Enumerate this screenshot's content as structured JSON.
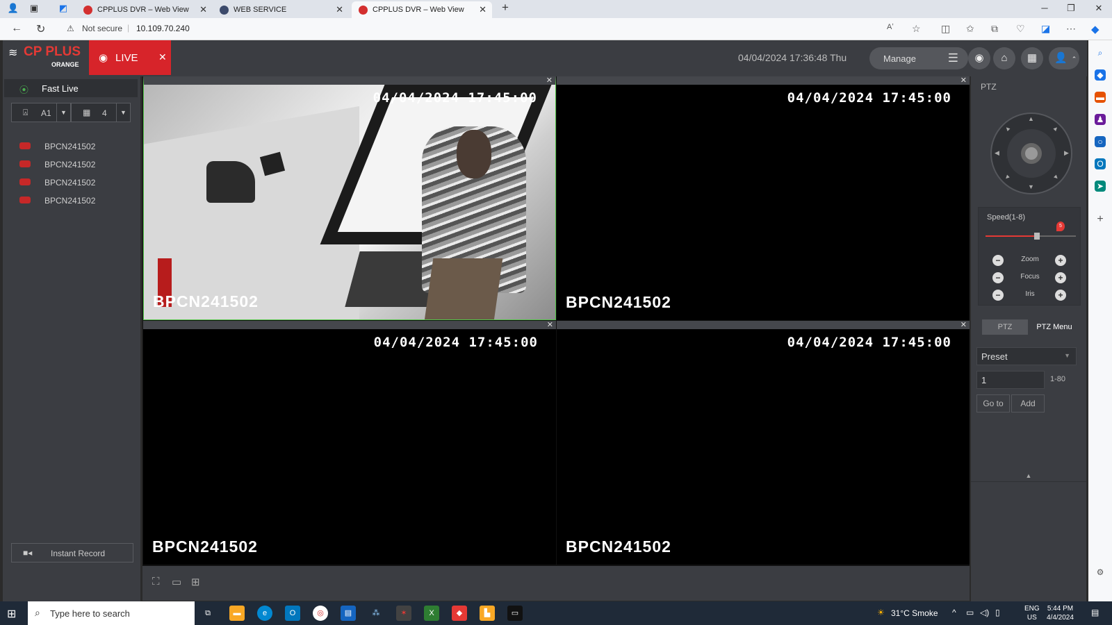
{
  "browser": {
    "tabs": [
      {
        "title": "CPPLUS DVR – Web View",
        "active": false
      },
      {
        "title": "WEB SERVICE",
        "active": false
      },
      {
        "title": "CPPLUS DVR – Web View",
        "active": true
      }
    ],
    "security_label": "Not secure",
    "url": "10.109.70.240"
  },
  "app": {
    "logo_main": "CP PLUS",
    "logo_sub": "ORANGE",
    "live_tab_label": "LIVE",
    "datetime": "04/04/2024 17:36:48 Thu",
    "manage_label": "Manage"
  },
  "sidebar": {
    "fast_live_label": "Fast Live",
    "channel_selector": "A1",
    "layout_selector": "4",
    "cameras": [
      "BPCN241502",
      "BPCN241502",
      "BPCN241502",
      "BPCN241502"
    ],
    "instant_record_label": "Instant Record"
  },
  "video": {
    "panes": [
      {
        "timestamp": "04/04/2024 17:45:00",
        "camera": "BPCN241502",
        "active": true
      },
      {
        "timestamp": "04/04/2024 17:45:00",
        "camera": "BPCN241502",
        "active": false
      },
      {
        "timestamp": "04/04/2024 17:45:00",
        "camera": "BPCN241502",
        "active": false
      },
      {
        "timestamp": "04/04/2024 17:45:00",
        "camera": "BPCN241502",
        "active": false
      }
    ]
  },
  "ptz": {
    "title": "PTZ",
    "speed_label": "Speed(1-8)",
    "speed_value": "5",
    "speed_fraction": 0.57,
    "zoom_label": "Zoom",
    "focus_label": "Focus",
    "iris_label": "Iris",
    "tab_ptz": "PTZ",
    "tab_menu": "PTZ Menu",
    "preset_select": "Preset",
    "preset_number": "1",
    "preset_range": "1-80",
    "goto_label": "Go to",
    "add_label": "Add"
  },
  "taskbar": {
    "search_placeholder": "Type here to search",
    "weather": "31°C  Smoke",
    "lang_line1": "ENG",
    "lang_line2": "US",
    "time": "5:44 PM",
    "date": "4/4/2024"
  },
  "colors": {
    "accent_red": "#d7242a",
    "panel_bg": "#3b3d42",
    "active_pane_border": "#54c748"
  }
}
